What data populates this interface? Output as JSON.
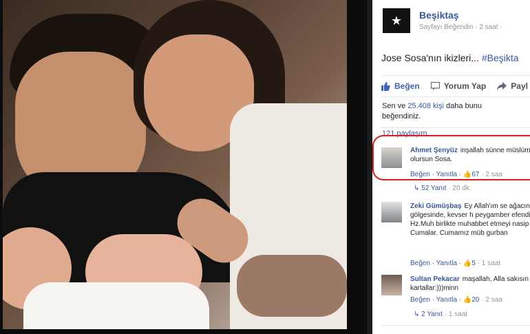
{
  "post": {
    "page_name": "Beşiktaş",
    "page_meta": "Sayfayı Beğendin · 2 saat ·",
    "text_prefix": "Jose Sosa'nın ikizleri... ",
    "hashtag": "#Beşikta",
    "actions": {
      "like": "Beğen",
      "comment": "Yorum Yap",
      "share": "Payl"
    },
    "likes_summary_prefix": "Sen ve ",
    "likes_count": "25.408",
    "likes_summary_mid": " kişi",
    "likes_summary_suffix": " daha bunu beğendiniz.",
    "shares": "121 paylaşım"
  },
  "comments": [
    {
      "author": "Ahmet Şenyüz",
      "text": "inşallah sünne müslüman olursun Sosa.",
      "actions": "Beğen · Yanıtla · ",
      "likes": "67",
      "time": " · 2 saa",
      "replies": "52 Yanıt",
      "replies_time": " · 20 dk."
    },
    {
      "author": "Zeki Gümüşbaş",
      "text": "Ey Allah'ım se ağacının gölgesinde, kevser h peygamber efendimiz Hz.Muh birlikte muhabbet etmeyi nasip nurlu Cumalar. Cumamız müb gurban",
      "actions": "Beğen · Yanıtla · ",
      "likes": "5",
      "time": " · 1 saat"
    },
    {
      "author": "Sultan Pekacar",
      "text": "maşallah, Alla sakısın yavru kartallar:)))minn",
      "actions": "Beğen · Yanıtla · ",
      "likes": "20",
      "time": " · 2 saa",
      "replies": "2 Yanıt",
      "replies_time": " · 1 saat"
    }
  ],
  "icons": {
    "logo": "besiktas-eagle-icon",
    "like": "thumbs-up-icon",
    "comment": "speech-bubble-icon",
    "share": "share-arrow-icon",
    "reply": "reply-arrow-icon"
  },
  "colors": {
    "facebook_blue": "#365899",
    "highlight_red": "#d81e1e"
  }
}
